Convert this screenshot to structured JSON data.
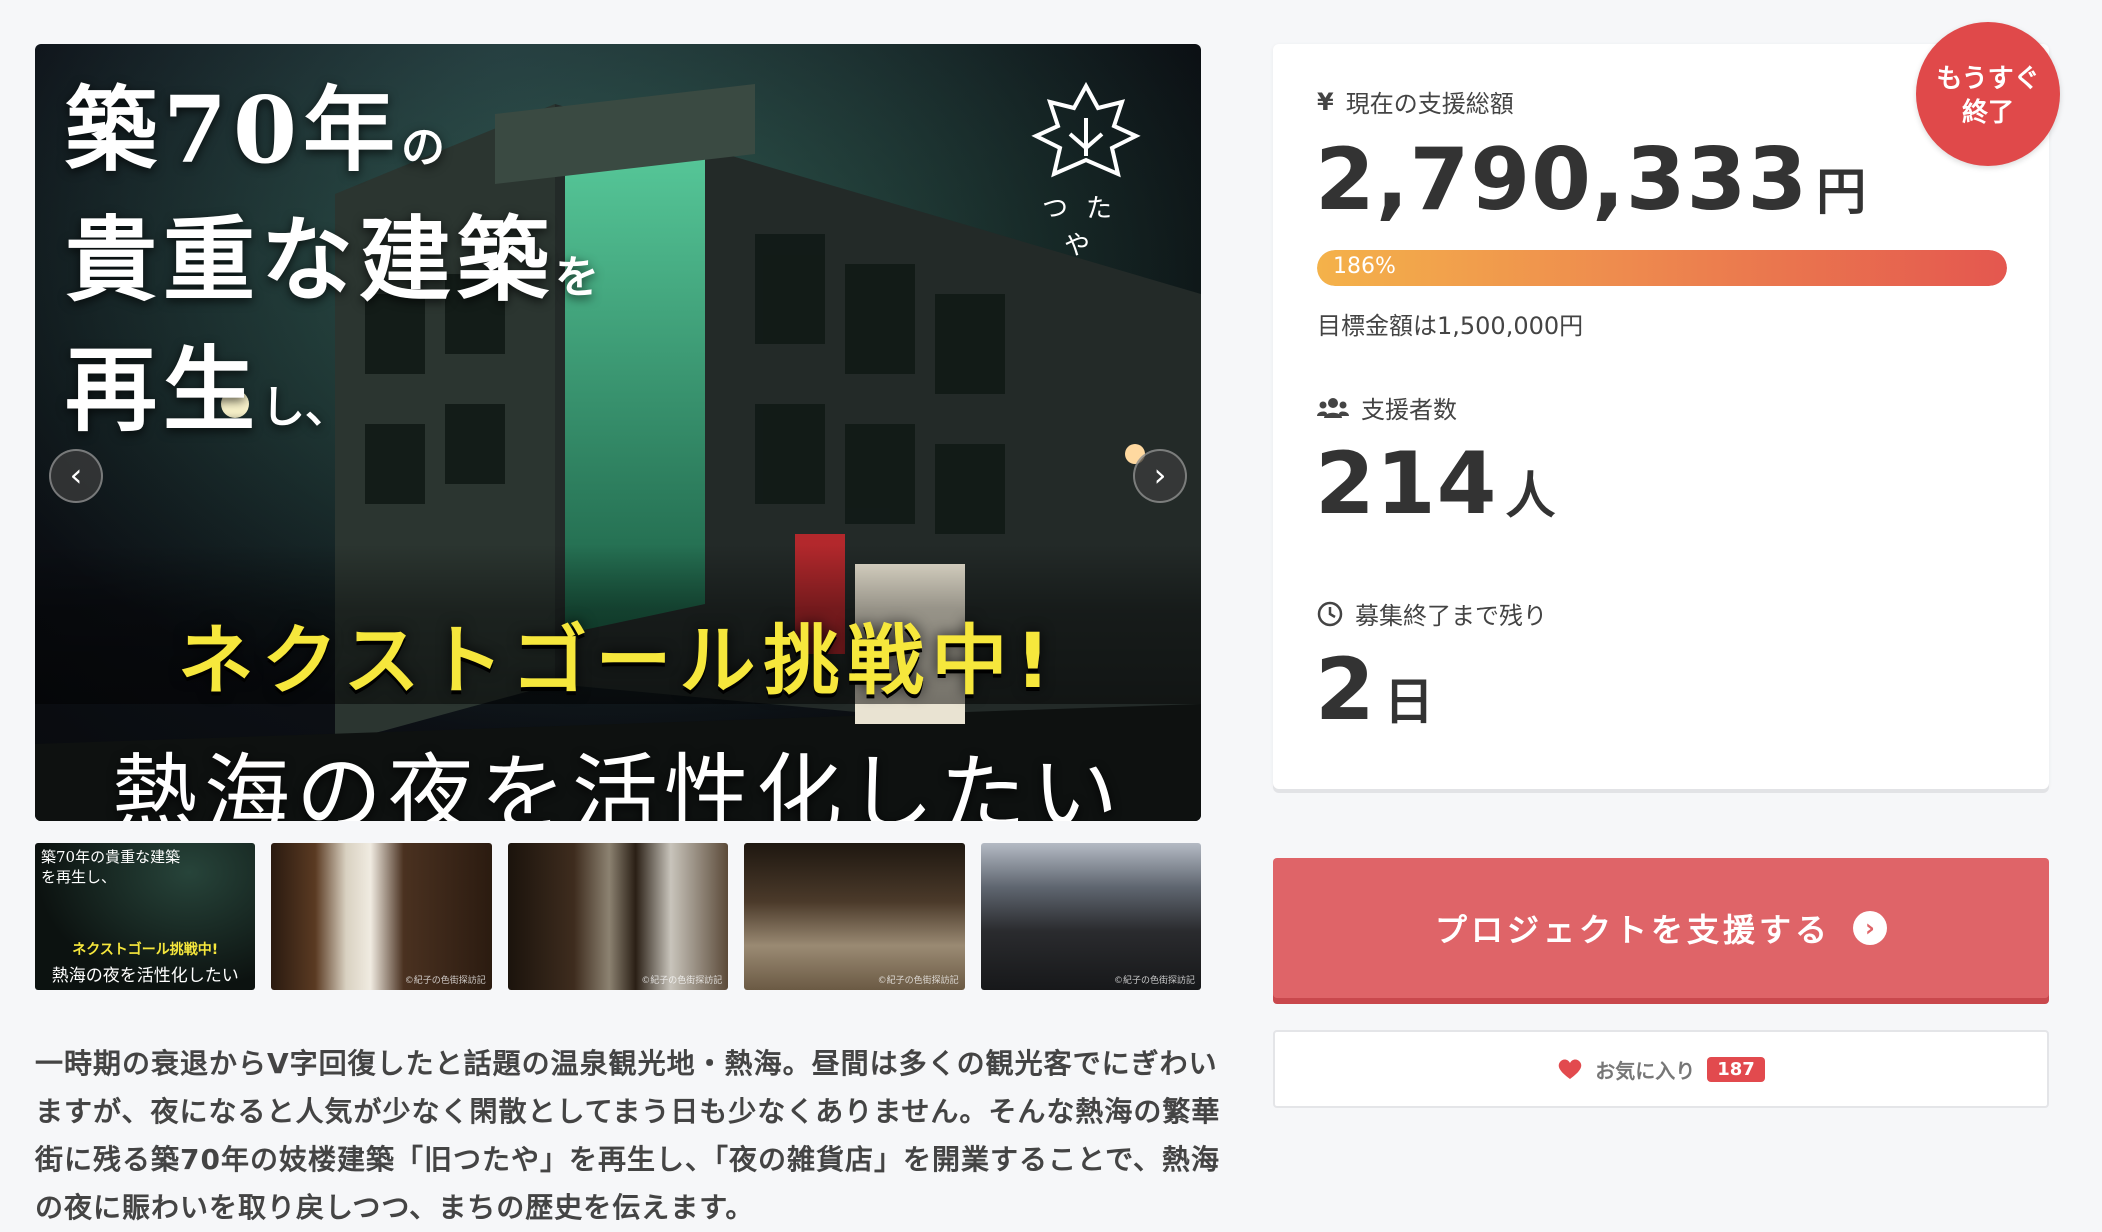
{
  "hero": {
    "title_line1": "築70年",
    "title_line1_suffix": "の",
    "title_line2": "貴重な建築",
    "title_line2_suffix": "を",
    "title_line3": "再生",
    "title_line3_suffix": "し、",
    "logo_text": "つたや",
    "banner": "ネクストゴール挑戦中!",
    "subtitle": "熱海の夜を活性化したい",
    "prev_label": "‹",
    "next_label": "›"
  },
  "thumbnails": {
    "t1_title": "築70年の貴重な建築を再生し、",
    "t1_banner": "ネクストゴール挑戦中!",
    "t1_sub": "熱海の夜を活性化したい",
    "t2_caption": "©紀子の色街探訪記",
    "t3_caption": "©紀子の色街探訪記",
    "t4_caption": "©紀子の色街探訪記",
    "t5_caption": "©紀子の色街探訪記"
  },
  "description": "一時期の衰退からV字回復したと話題の温泉観光地・熱海。昼間は多くの観光客でにぎわいますが、夜になると人気が少なく閑散としてまう日も少なくありません。そんな熱海の繁華街に残る築70年の妓楼建築「旧つたや」を再生し、「夜の雑貨店」を開業することで、熱海の夜に賑わいを取り戻しつつ、まちの歴史を伝えます。",
  "badge": {
    "line1": "もうすぐ",
    "line2": "終了"
  },
  "stats": {
    "funding_label": "現在の支援総額",
    "funding_icon": "¥",
    "funding_value": "2,790,333",
    "funding_unit": "円",
    "progress_percent": 186,
    "progress_label": "186%",
    "goal_text": "目標金額は1,500,000円",
    "backers_label": "支援者数",
    "backers_value": "214",
    "backers_unit": "人",
    "remaining_label": "募集終了まで残り",
    "remaining_value": "2",
    "remaining_unit": "日"
  },
  "actions": {
    "support_label": "プロジェクトを支援する",
    "support_icon": "›",
    "favorite_label": "お気に入り",
    "favorite_count": "187"
  },
  "colors": {
    "accent": "#df6468",
    "badge": "#e0494a",
    "progress_start": "#f4b24a",
    "progress_end": "#e4574f",
    "banner_yellow": "#f6e73c"
  }
}
